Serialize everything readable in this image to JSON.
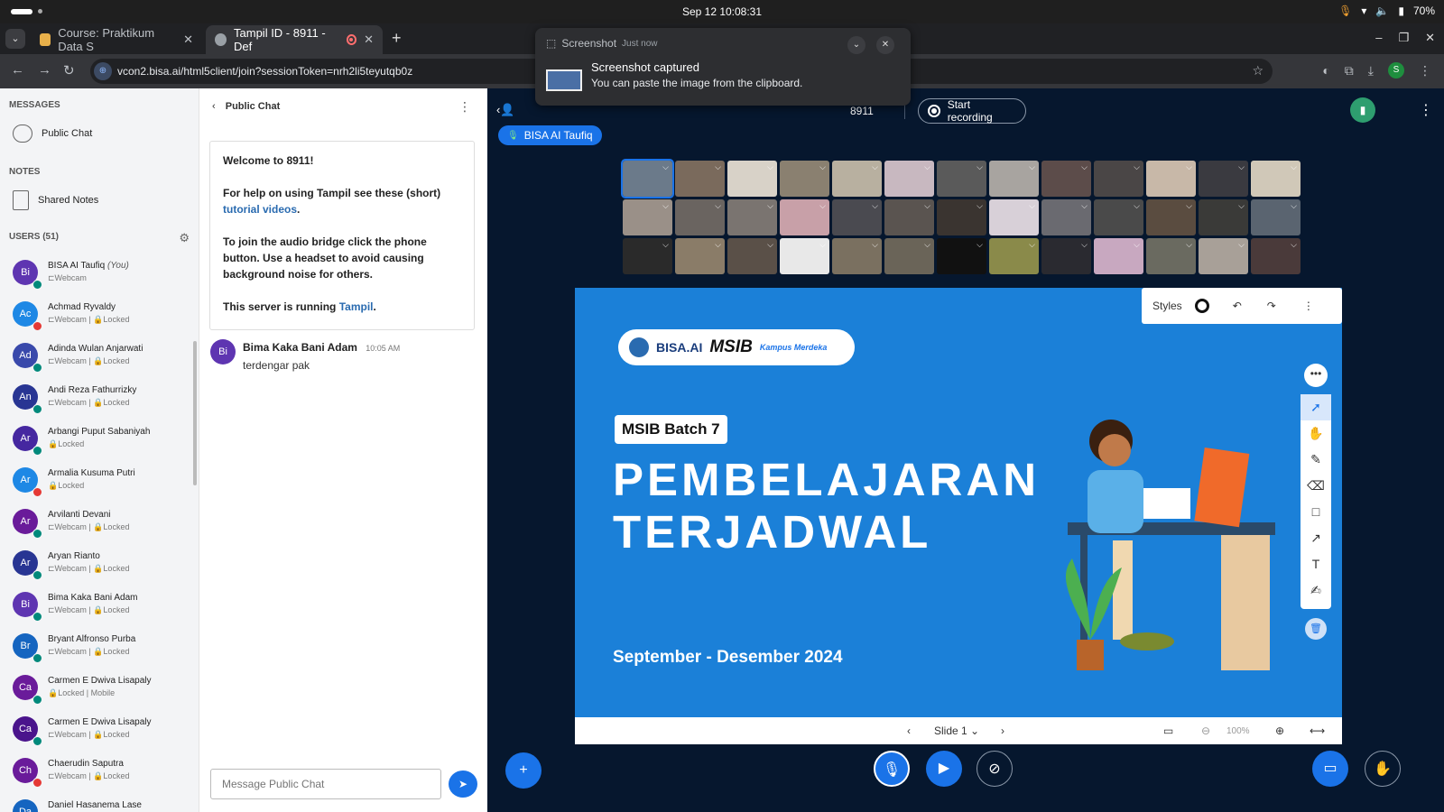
{
  "system": {
    "clock": "Sep 12  10:08:31",
    "battery": "70%"
  },
  "tabs": [
    {
      "label": "Course: Praktikum Data S",
      "close": "✕"
    },
    {
      "label": "Tampil ID - 8911 - Def",
      "close": "✕"
    }
  ],
  "address": {
    "url": "vcon2.bisa.ai/html5client/join?sessionToken=nrh2li5teyutqb0z"
  },
  "notification": {
    "app": "Screenshot",
    "time": "Just now",
    "title": "Screenshot captured",
    "body": "You can paste the image from the clipboard."
  },
  "sidebar": {
    "messages_label": "MESSAGES",
    "public_chat": "Public Chat",
    "notes_label": "NOTES",
    "shared_notes": "Shared Notes",
    "users_label": "USERS (51)",
    "users": [
      {
        "initials": "Bi",
        "name": "BISA AI Taufiq",
        "you": "(You)",
        "status": "⊏Webcam",
        "color": "#5e35b1",
        "badge": "#00897b"
      },
      {
        "initials": "Ac",
        "name": "Achmad Ryvaldy",
        "status": "⊏Webcam | 🔒Locked",
        "color": "#1e88e5",
        "badge": "#e53935"
      },
      {
        "initials": "Ad",
        "name": "Adinda Wulan Anjarwati",
        "status": "⊏Webcam | 🔒Locked",
        "color": "#3949ab",
        "badge": "#00897b"
      },
      {
        "initials": "An",
        "name": "Andi Reza Fathurrizky",
        "status": "⊏Webcam | 🔒Locked",
        "color": "#283593",
        "badge": "#00897b"
      },
      {
        "initials": "Ar",
        "name": "Arbangi Puput Sabaniyah",
        "status": "🔒Locked",
        "color": "#4527a0",
        "badge": "#00897b"
      },
      {
        "initials": "Ar",
        "name": "Armalia Kusuma Putri",
        "status": "🔒Locked",
        "color": "#1e88e5",
        "badge": "#e53935"
      },
      {
        "initials": "Ar",
        "name": "Arvilanti Devani",
        "status": "⊏Webcam | 🔒Locked",
        "color": "#6a1b9a",
        "badge": "#00897b"
      },
      {
        "initials": "Ar",
        "name": "Aryan Rianto",
        "status": "⊏Webcam | 🔒Locked",
        "color": "#283593",
        "badge": "#00897b"
      },
      {
        "initials": "Bi",
        "name": "Bima Kaka Bani Adam",
        "status": "⊏Webcam | 🔒Locked",
        "color": "#5e35b1",
        "badge": "#00897b"
      },
      {
        "initials": "Br",
        "name": "Bryant Alfronso Purba",
        "status": "⊏Webcam | 🔒Locked",
        "color": "#1565c0",
        "badge": "#00897b"
      },
      {
        "initials": "Ca",
        "name": "Carmen E Dwiva Lisapaly",
        "status": "🔒Locked | Mobile",
        "color": "#6a1b9a",
        "badge": "#00897b"
      },
      {
        "initials": "Ca",
        "name": "Carmen E Dwiva Lisapaly",
        "status": "⊏Webcam | 🔒Locked",
        "color": "#4a148c",
        "badge": "#00897b"
      },
      {
        "initials": "Ch",
        "name": "Chaerudin Saputra",
        "status": "⊏Webcam | 🔒Locked",
        "color": "#6a1b9a",
        "badge": "#e53935"
      },
      {
        "initials": "Da",
        "name": "Daniel Hasanema Lase",
        "status": "",
        "color": "#1565c0",
        "badge": "#00897b"
      }
    ]
  },
  "chat": {
    "title": "Public Chat",
    "welcome_title": "Welcome to 8911!",
    "help_text": "For help on using Tampil see these (short)",
    "help_link": "tutorial videos",
    "audio_text": "To join the audio bridge click the phone button. Use a headset to avoid causing background noise for others.",
    "server_text": "This server is running",
    "server_link": "Tampil",
    "message": {
      "initials": "Bi",
      "author": "Bima Kaka Bani Adam",
      "time": "10:05 AM",
      "text": "terdengar pak"
    },
    "input_placeholder": "Message Public Chat"
  },
  "meeting": {
    "room": "8911",
    "record_label": "Start recording",
    "talker": "BISA AI Taufiq",
    "cam_colors": [
      "#6b7a8a",
      "#7a6a5c",
      "#d8d2c8",
      "#8a8070",
      "#b8b0a0",
      "#c8b8c0",
      "#5a5a5a",
      "#a8a4a0",
      "#5c4c4a",
      "#4a4646",
      "#c8b8a8",
      "#3a3a40",
      "#d0c8b8",
      "#9a9088",
      "#6a6460",
      "#7a7470",
      "#c8a0a8",
      "#4a4a50",
      "#5a5450",
      "#3a3430",
      "#d8d0d8",
      "#6a6a70",
      "#4a4a4a",
      "#5a4c40",
      "#3a3a38",
      "#5a6470",
      "#2a2a2a",
      "#8a7c68",
      "#5a5048",
      "#e8e8e8",
      "#7a7060",
      "#6a6458",
      "#111111",
      "#8a8a4a",
      "#2a2a30",
      "#c8a8c0",
      "#6a6a60",
      "#a8a098",
      "#4a3a3a"
    ],
    "styles_label": "Styles",
    "slide_label": "Slide 1",
    "zoom": "100%"
  },
  "slide": {
    "logo_text": "BISA.AI",
    "logo_msib": "MSIB",
    "logo_km": "Kampus Merdeka",
    "batch": "MSIB Batch 7",
    "title_line1": "PEMBELAJARAN",
    "title_line2": "TERJADWAL",
    "date": "September - Desember 2024"
  }
}
